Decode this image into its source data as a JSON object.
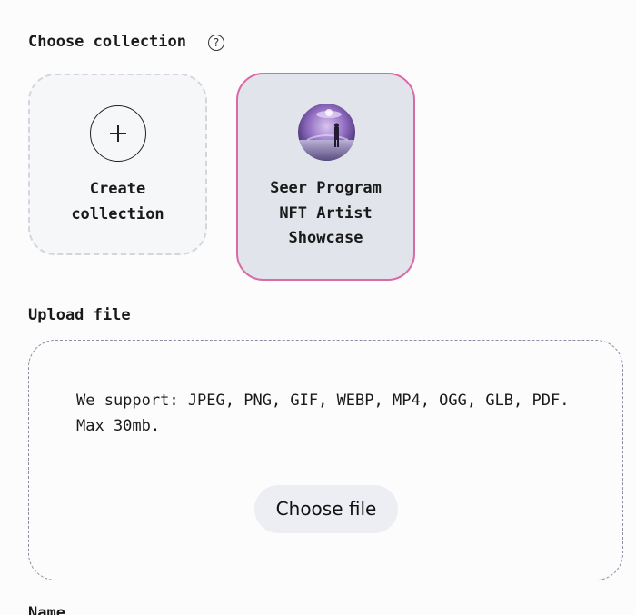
{
  "collection": {
    "title": "Choose collection",
    "help_icon": "question-circle-icon",
    "cards": [
      {
        "label": "Create\ncollection",
        "icon": "plus-circle-icon",
        "selected": false
      },
      {
        "label": "Seer Program\nNFT Artist\nShowcase",
        "icon": "collection-avatar",
        "selected": true
      }
    ],
    "selected_border_color": "#d96aa6"
  },
  "upload": {
    "title": "Upload file",
    "support_text": "We support: JPEG, PNG, GIF, WEBP, MP4, OGG, GLB, PDF. Max 30mb.",
    "button_label": "Choose file"
  },
  "name_field": {
    "title": "Name"
  }
}
